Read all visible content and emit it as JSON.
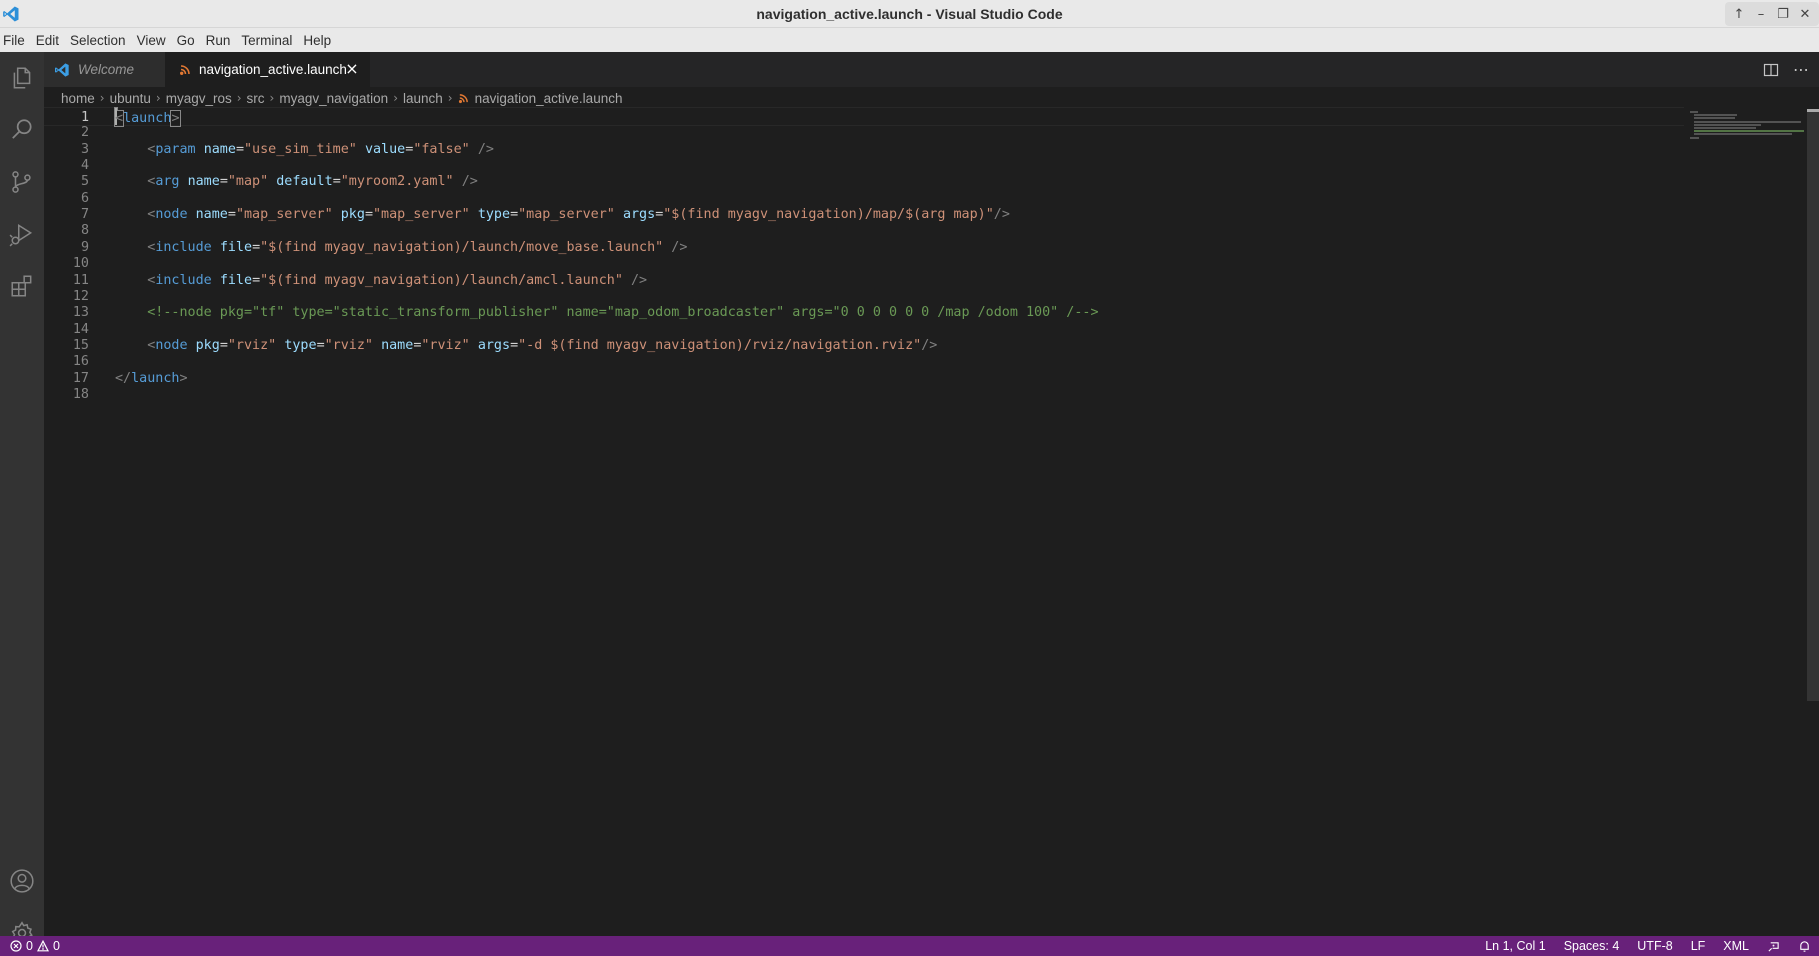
{
  "window": {
    "title": "navigation_active.launch - Visual Studio Code",
    "controls": [
      "↑",
      "–",
      "❐",
      "✕"
    ]
  },
  "menu": [
    "File",
    "Edit",
    "Selection",
    "View",
    "Go",
    "Run",
    "Terminal",
    "Help"
  ],
  "activity_bar": {
    "top": [
      "files-icon",
      "search-icon",
      "source-control-icon",
      "run-debug-icon",
      "extensions-icon"
    ],
    "bottom": [
      "account-icon",
      "settings-gear-icon"
    ]
  },
  "tabs": [
    {
      "label": "Welcome",
      "icon": "vscode-logo-icon",
      "active": false
    },
    {
      "label": "navigation_active.launch",
      "icon": "rss-file-icon",
      "active": true
    }
  ],
  "breadcrumb": [
    "home",
    "ubuntu",
    "myagv_ros",
    "src",
    "myagv_navigation",
    "launch",
    "navigation_active.launch"
  ],
  "editor": {
    "current_line": 1,
    "lines": [
      "<launch>",
      "",
      "    <param name=\"use_sim_time\" value=\"false\" />",
      "",
      "    <arg name=\"map\" default=\"myroom2.yaml\" />",
      "",
      "    <node name=\"map_server\" pkg=\"map_server\" type=\"map_server\" args=\"$(find myagv_navigation)/map/$(arg map)\"/>",
      "",
      "    <include file=\"$(find myagv_navigation)/launch/move_base.launch\" />",
      "",
      "    <include file=\"$(find myagv_navigation)/launch/amcl.launch\" />",
      "",
      "    <!--node pkg=\"tf\" type=\"static_transform_publisher\" name=\"map_odom_broadcaster\" args=\"0 0 0 0 0 0 /map /odom 100\" /-->",
      "",
      "    <node pkg=\"rviz\" type=\"rviz\" name=\"rviz\" args=\"-d $(find myagv_navigation)/rviz/navigation.rviz\"/>",
      "",
      "</launch>",
      ""
    ]
  },
  "statusbar": {
    "errors": "0",
    "warnings": "0",
    "position": "Ln 1, Col 1",
    "spaces": "Spaces: 4",
    "encoding": "UTF-8",
    "eol": "LF",
    "language": "XML"
  },
  "colors": {
    "statusbar": "#68217a",
    "editor_bg": "#1e1e1e",
    "activity_bar": "#333333",
    "tag": "#569cd6",
    "attribute": "#9cdcfe",
    "string": "#ce9178",
    "comment": "#6a9955"
  }
}
